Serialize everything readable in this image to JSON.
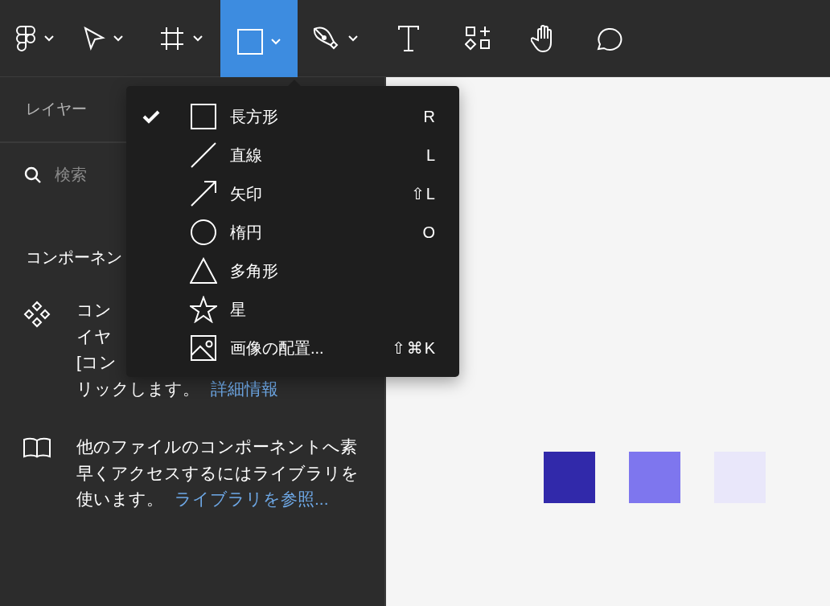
{
  "toolbar": {
    "tools": [
      {
        "selected": false,
        "dropdown": true
      },
      {
        "selected": false,
        "dropdown": true
      },
      {
        "selected": false,
        "dropdown": true
      },
      {
        "selected": true,
        "dropdown": true
      },
      {
        "selected": false,
        "dropdown": true
      },
      {
        "selected": false,
        "dropdown": false
      },
      {
        "selected": false,
        "dropdown": false
      },
      {
        "selected": false,
        "dropdown": false
      },
      {
        "selected": false,
        "dropdown": false
      }
    ]
  },
  "panel": {
    "tabs": [
      {
        "label": "レイヤー",
        "selected": false
      }
    ],
    "search": {
      "placeholder": "検索"
    },
    "heading": "コンポーネン",
    "tips": [
      {
        "lines": [
          "コン",
          "イヤ",
          "[コン",
          "リックします。"
        ],
        "link": "詳細情報"
      },
      {
        "lines": [
          "他のファイルのコンポーネントへ素",
          "早くアクセスするにはライブラリを",
          "使います。"
        ],
        "link": "ライブラリを参照..."
      }
    ]
  },
  "shape_menu": {
    "items": [
      {
        "label": "長方形",
        "shortcut": "R",
        "checked": true
      },
      {
        "label": "直線",
        "shortcut": "L",
        "checked": false
      },
      {
        "label": "矢印",
        "shortcut": "⇧L",
        "checked": false
      },
      {
        "label": "楕円",
        "shortcut": "O",
        "checked": false
      },
      {
        "label": "多角形",
        "checked": false
      },
      {
        "label": "星",
        "checked": false
      },
      {
        "label": "画像の配置...",
        "shortcut": "⇧⌘K",
        "checked": false
      }
    ]
  },
  "canvas": {
    "swatches": [
      {
        "color": "#3129aa"
      },
      {
        "color": "#7e76ee"
      },
      {
        "color": "#e9e7fa"
      }
    ]
  }
}
